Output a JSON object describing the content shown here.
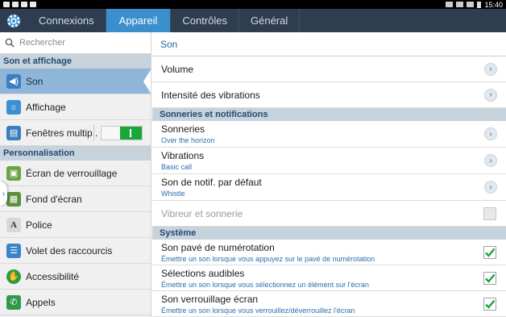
{
  "statusbar": {
    "time": "15:40"
  },
  "tabs": [
    {
      "label": "Connexions"
    },
    {
      "label": "Appareil"
    },
    {
      "label": "Contrôles"
    },
    {
      "label": "Général"
    }
  ],
  "sidebar": {
    "search_placeholder": "Rechercher",
    "section1": "Son et affichage",
    "section2": "Personnalisation",
    "items": [
      {
        "label": "Son",
        "icon": "speaker-icon"
      },
      {
        "label": "Affichage",
        "icon": "brightness-icon"
      },
      {
        "label": "Fenêtres multip..",
        "icon": "multiwindow-icon"
      },
      {
        "label": "Écran de verrouillage",
        "icon": "lockscreen-icon"
      },
      {
        "label": "Fond d'écran",
        "icon": "wallpaper-icon"
      },
      {
        "label": "Police",
        "icon": "font-icon"
      },
      {
        "label": "Volet des raccourcis",
        "icon": "shortcuts-icon"
      },
      {
        "label": "Accessibilité",
        "icon": "accessibility-icon"
      },
      {
        "label": "Appels",
        "icon": "phone-icon"
      }
    ]
  },
  "main": {
    "title": "Son",
    "volume": "Volume",
    "vibration_intensity": "Intensité des vibrations",
    "section_notifications": "Sonneries et notifications",
    "ringtones": {
      "label": "Sonneries",
      "value": "Over the horizon"
    },
    "vibrations": {
      "label": "Vibrations",
      "value": "Basic call"
    },
    "default_notif": {
      "label": "Son de notif. par défaut",
      "value": "Whistle"
    },
    "vibrate_ring": "Vibreur et sonnerie",
    "section_system": "Système",
    "keypad": {
      "label": "Son pavé de numérotation",
      "desc": "Émettre un son lorsque vous appuyez sur le pavé de numérotation"
    },
    "selection": {
      "label": "Sélections audibles",
      "desc": "Émettre un son lorsque vous sélectionnez un élément sur l'écran"
    },
    "lockscreen": {
      "label": "Son verrouillage écran",
      "desc": "Émettre un son lorsque vous verrouillez/déverrouillez l'écran"
    }
  },
  "colors": {
    "accent": "#3b8fcc",
    "tabbar": "#2e3d4f",
    "section": "#c6d2dc",
    "check": "#1aa63a"
  }
}
